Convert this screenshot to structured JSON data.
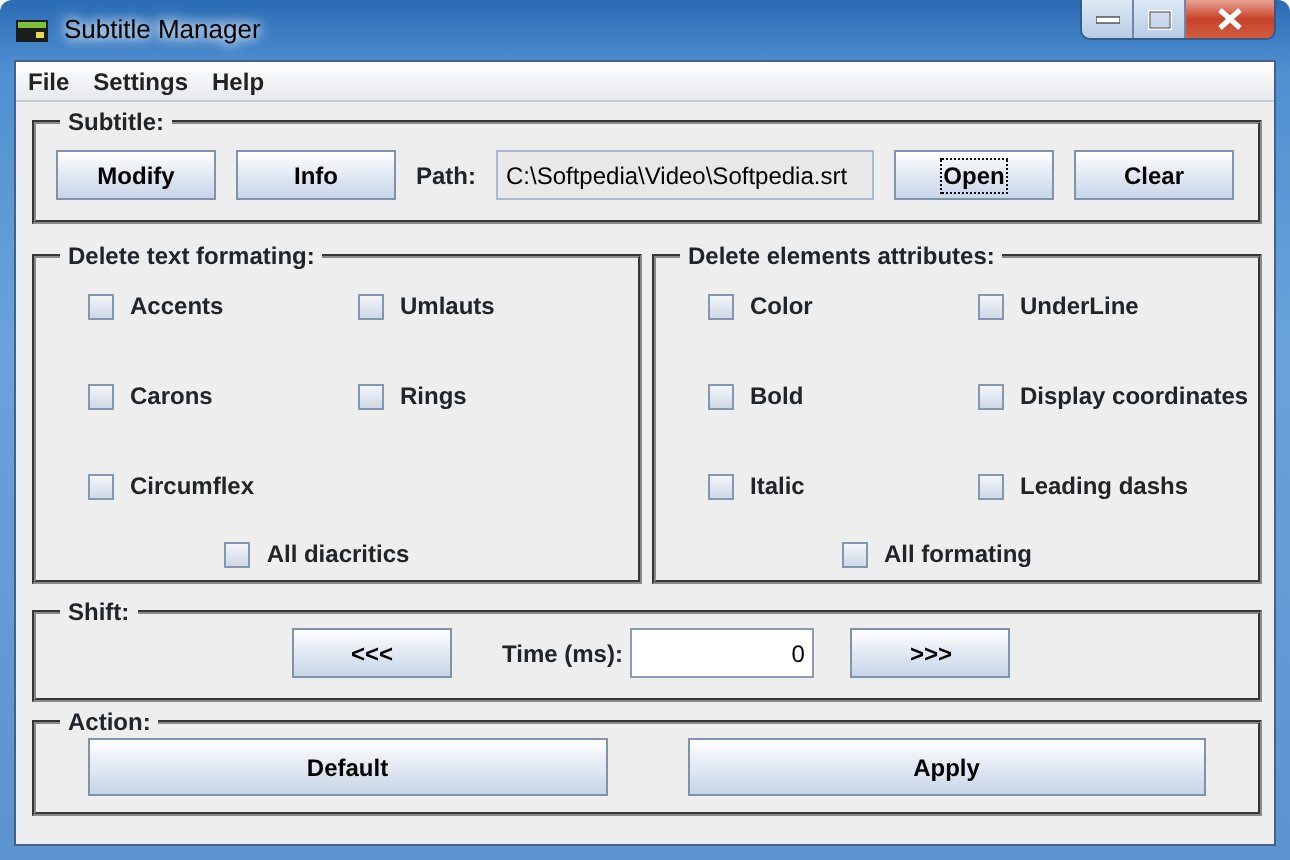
{
  "window": {
    "title": "Subtitle Manager"
  },
  "menu": [
    "File",
    "Settings",
    "Help"
  ],
  "subtitle": {
    "title": "Subtitle:",
    "left_buttons": [
      "Modify",
      "Info"
    ],
    "path": {
      "label": "Path:",
      "value": "C:\\Softpedia\\Video\\Softpedia.srt"
    },
    "right_buttons": [
      {
        "label": "Open",
        "focused": true
      },
      {
        "label": "Clear",
        "focused": false
      }
    ]
  },
  "groups": [
    {
      "title": "Delete text formating:",
      "options": [
        {
          "label": "Accents",
          "checked": false
        },
        {
          "label": "Umlauts",
          "checked": false
        },
        {
          "label": "Carons",
          "checked": false
        },
        {
          "label": "Rings",
          "checked": false
        },
        {
          "label": "Circumflex",
          "checked": false
        }
      ],
      "all": {
        "label": "All diacritics",
        "checked": false
      }
    },
    {
      "title": "Delete elements attributes:",
      "options": [
        {
          "label": "Color",
          "checked": false
        },
        {
          "label": "UnderLine",
          "checked": false
        },
        {
          "label": "Bold",
          "checked": false
        },
        {
          "label": "Display coordinates",
          "checked": false
        },
        {
          "label": "Italic",
          "checked": false
        },
        {
          "label": "Leading dashs",
          "checked": false
        }
      ],
      "all": {
        "label": "All formating",
        "checked": false
      }
    }
  ],
  "shift": {
    "title": "Shift:",
    "back": "<<<",
    "time_label": "Time (ms):",
    "time_value": "0",
    "forward": ">>>"
  },
  "action": {
    "title": "Action:",
    "buttons": [
      "Default",
      "Apply"
    ]
  }
}
